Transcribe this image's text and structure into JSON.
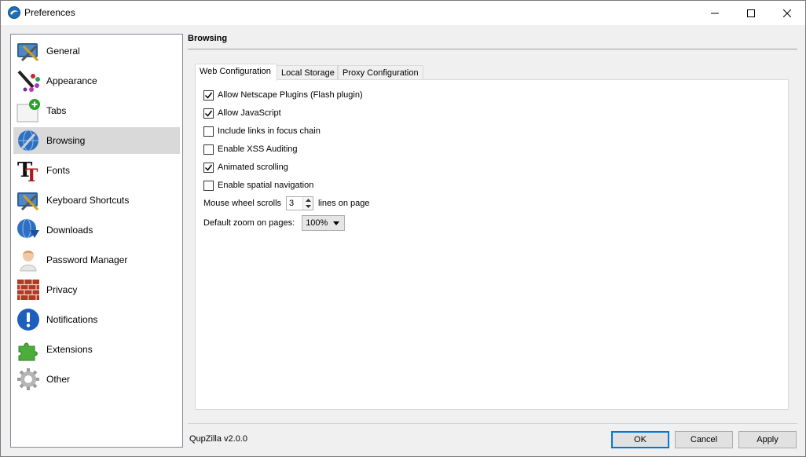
{
  "window": {
    "title": "Preferences",
    "colors": {
      "accent": "#0078d7",
      "selected_bg": "#d9d9d9",
      "panel_bg": "#ffffff",
      "chrome_bg": "#f0f0f0"
    }
  },
  "sidebar": {
    "selected": "Browsing",
    "items": [
      {
        "label": "General",
        "icon": "general-tools-icon"
      },
      {
        "label": "Appearance",
        "icon": "paint-palette-icon"
      },
      {
        "label": "Tabs",
        "icon": "new-tab-plus-icon"
      },
      {
        "label": "Browsing",
        "icon": "globe-wrench-icon"
      },
      {
        "label": "Fonts",
        "icon": "font-t-icon"
      },
      {
        "label": "Keyboard Shortcuts",
        "icon": "keyboard-tools-icon"
      },
      {
        "label": "Downloads",
        "icon": "download-globe-icon"
      },
      {
        "label": "Password Manager",
        "icon": "user-person-icon"
      },
      {
        "label": "Privacy",
        "icon": "brick-wall-icon"
      },
      {
        "label": "Notifications",
        "icon": "info-exclamation-icon"
      },
      {
        "label": "Extensions",
        "icon": "puzzle-piece-icon"
      },
      {
        "label": "Other",
        "icon": "gear-icon"
      }
    ]
  },
  "main": {
    "section_title": "Browsing",
    "tabs": [
      {
        "label": "Web Configuration",
        "active": true
      },
      {
        "label": "Local Storage",
        "active": false
      },
      {
        "label": "Proxy Configuration",
        "active": false
      }
    ],
    "options": [
      {
        "label": "Allow Netscape Plugins (Flash plugin)",
        "checked": true
      },
      {
        "label": "Allow JavaScript",
        "checked": true
      },
      {
        "label": "Include links in focus chain",
        "checked": false
      },
      {
        "label": "Enable XSS Auditing",
        "checked": false
      },
      {
        "label": "Animated scrolling",
        "checked": true
      },
      {
        "label": "Enable spatial navigation",
        "checked": false
      }
    ],
    "wheel": {
      "prefix": "Mouse wheel scrolls",
      "value": "3",
      "suffix": "lines on page"
    },
    "zoom": {
      "label": "Default zoom on pages:",
      "value": "100%"
    }
  },
  "footer": {
    "version": "QupZilla v2.0.0",
    "ok_label": "OK",
    "cancel_label": "Cancel",
    "apply_label": "Apply"
  }
}
